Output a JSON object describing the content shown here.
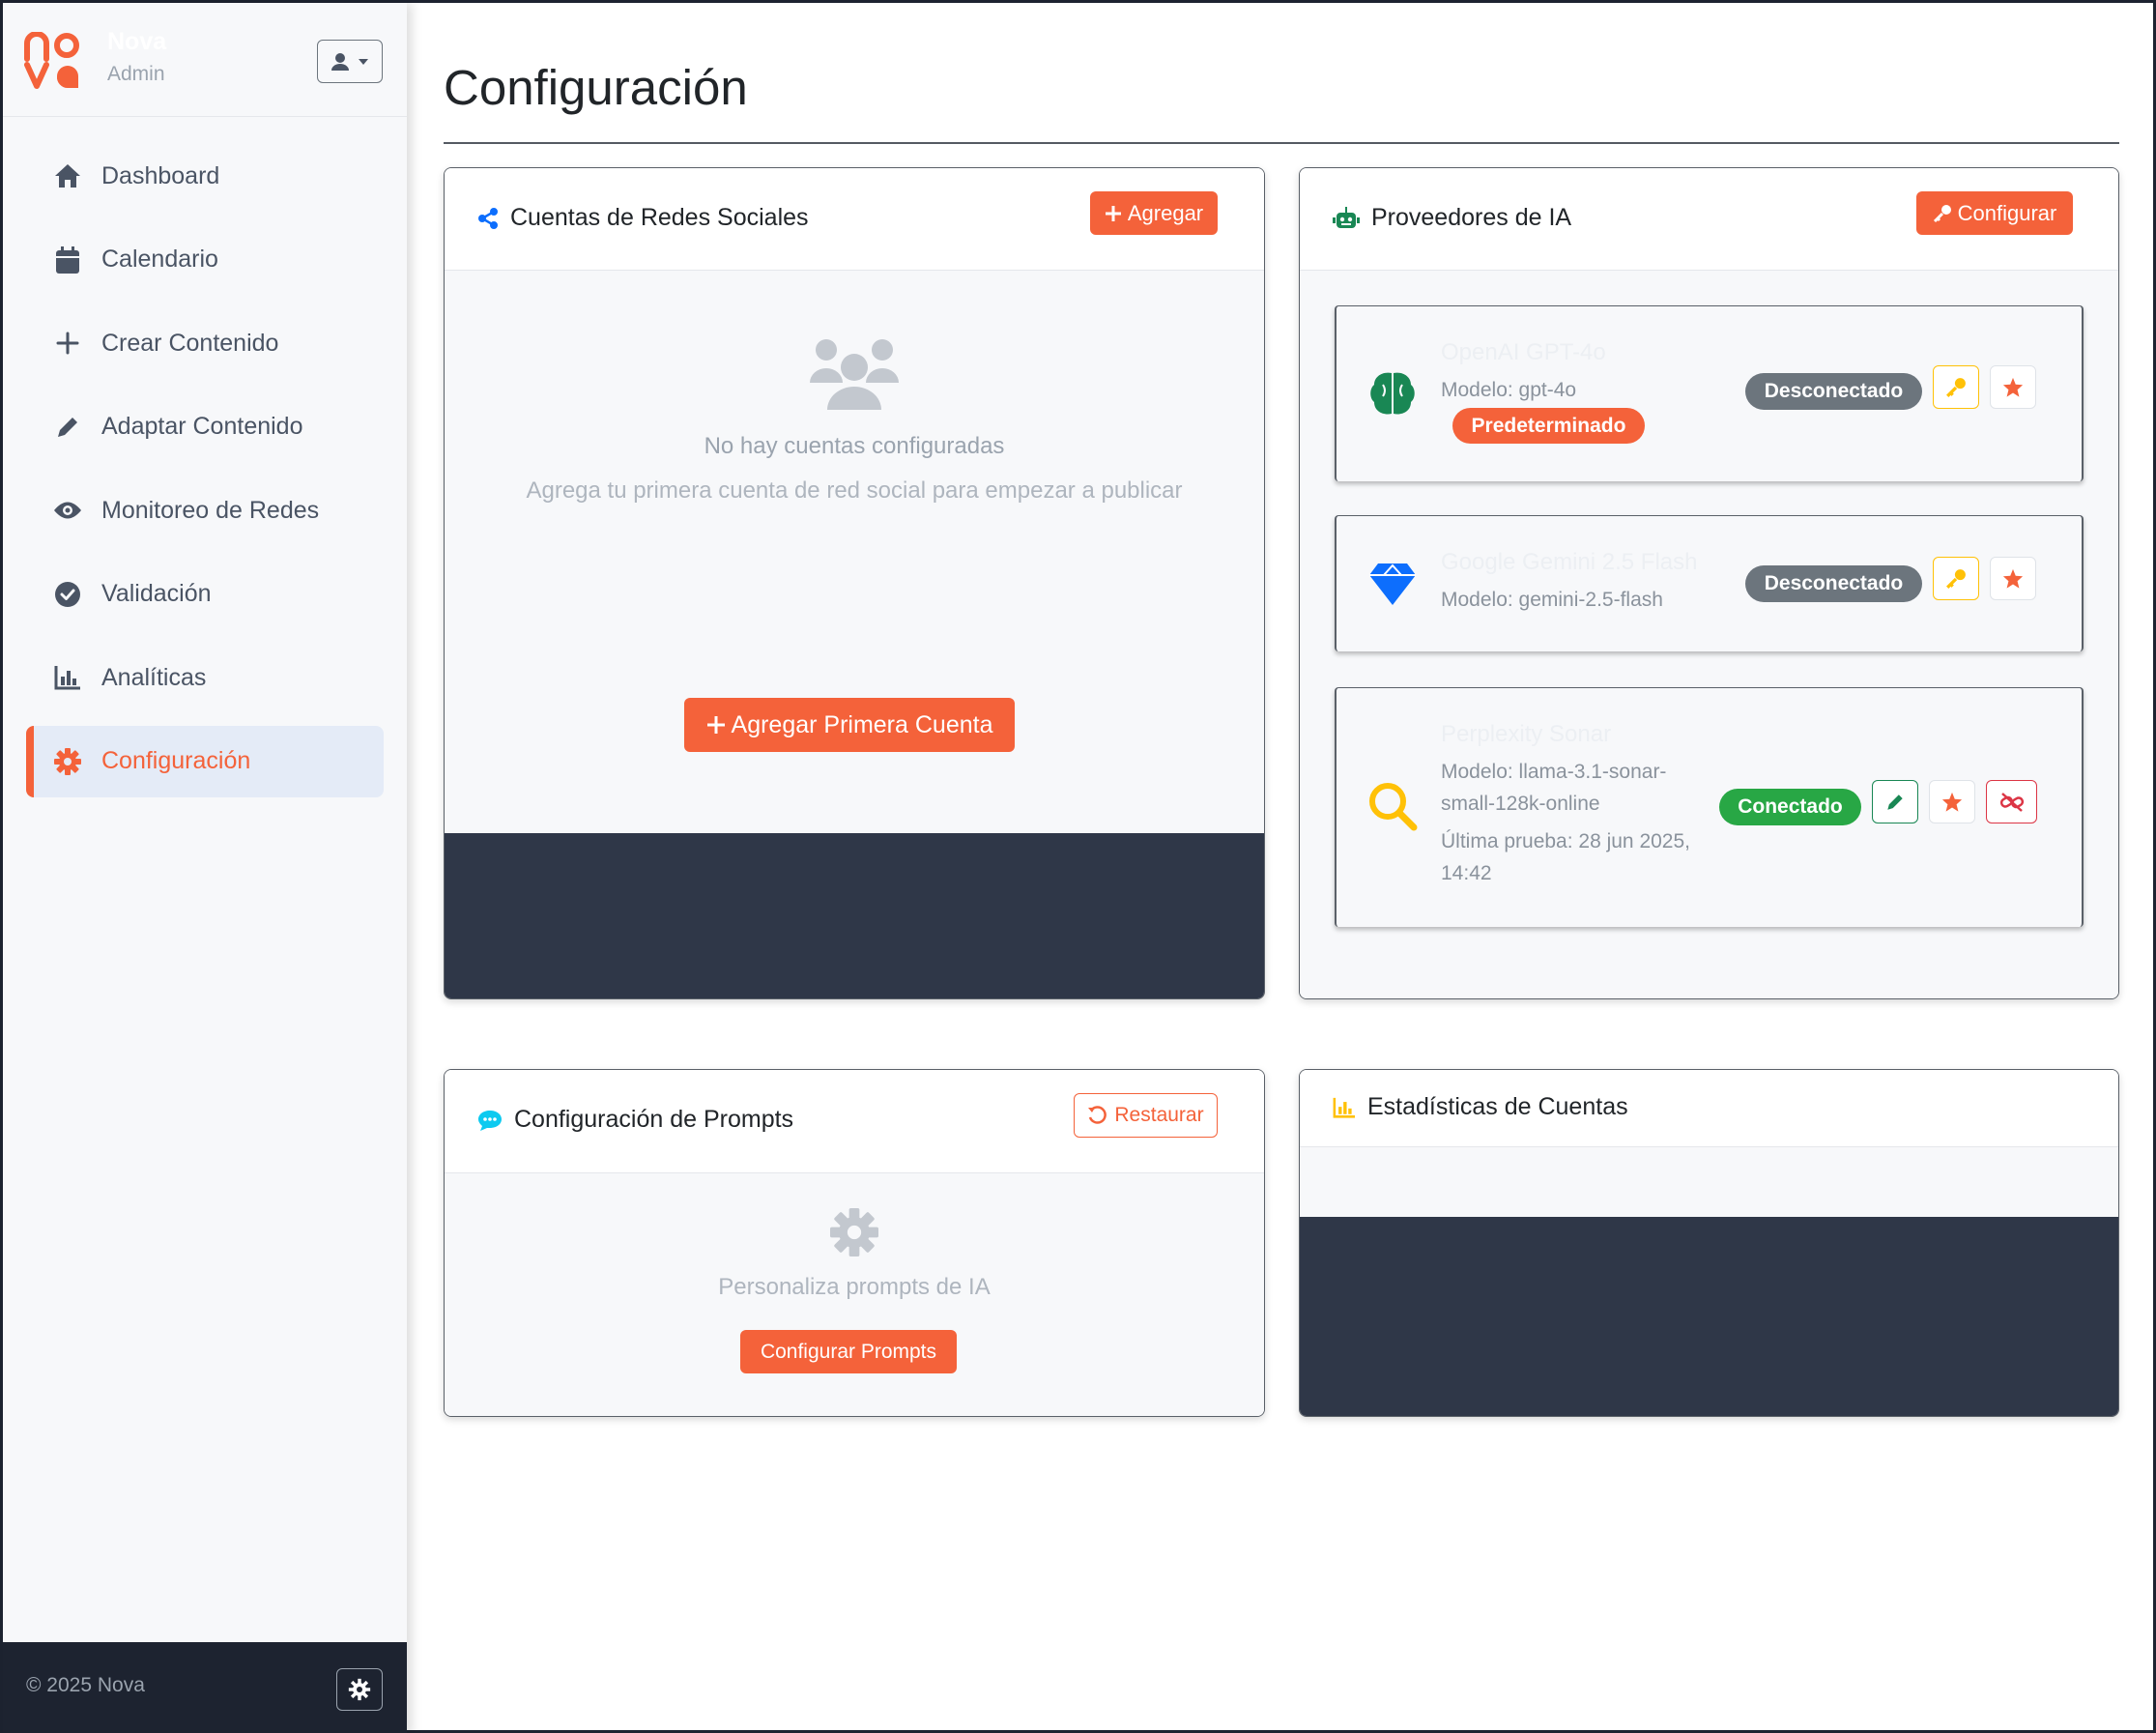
{
  "brand": {
    "name": "Nova",
    "role": "Admin",
    "logo_text": "nova"
  },
  "sidebar": {
    "items": [
      {
        "label": "Dashboard",
        "icon": "home-icon"
      },
      {
        "label": "Calendario",
        "icon": "calendar-icon"
      },
      {
        "label": "Crear Contenido",
        "icon": "plus-icon"
      },
      {
        "label": "Adaptar Contenido",
        "icon": "pencil-icon"
      },
      {
        "label": "Monitoreo de Redes",
        "icon": "eye-icon"
      },
      {
        "label": "Validación",
        "icon": "check-circle-icon"
      },
      {
        "label": "Analíticas",
        "icon": "chart-bar-icon"
      },
      {
        "label": "Configuración",
        "icon": "gear-icon",
        "active": true
      }
    ],
    "footer": {
      "copyright": "© 2025 Nova"
    }
  },
  "page": {
    "title": "Configuración"
  },
  "social_card": {
    "title": "Cuentas de Redes Sociales",
    "add_button": "Agregar",
    "empty_title": "No hay cuentas configuradas",
    "empty_subtitle": "Agrega tu primera cuenta de red social para empezar a publicar",
    "first_account_button": "Agregar Primera Cuenta"
  },
  "ai_card": {
    "title": "Proveedores de IA",
    "configure_button": "Configurar",
    "providers": [
      {
        "name": "OpenAI GPT-4o",
        "model": "Modelo: gpt-4o",
        "default_badge": "Predeterminado",
        "status": "Desconectado",
        "icon": "brain-icon"
      },
      {
        "name": "Google Gemini 2.5 Flash",
        "model": "Modelo: gemini-2.5-flash",
        "status": "Desconectado",
        "icon": "gem-icon"
      },
      {
        "name": "Perplexity Sonar",
        "model_line1": "Modelo: llama-3.1-sonar-",
        "model_line2": "small-128k-online",
        "test_line1": "Última prueba: 28 jun 2025,",
        "test_line2": "14:42",
        "status": "Conectado",
        "icon": "search-icon"
      }
    ]
  },
  "prompts_card": {
    "title": "Configuración de Prompts",
    "restore_button": "Restaurar",
    "text": "Personaliza prompts de IA",
    "configure_button": "Configurar Prompts"
  },
  "stats_card": {
    "title": "Estadísticas de Cuentas"
  },
  "colors": {
    "accent": "#f4623a",
    "sidebar_bg": "#f7f8fa",
    "dark": "#2f3748",
    "connected": "#28a745",
    "disconnected": "#6c757d"
  }
}
